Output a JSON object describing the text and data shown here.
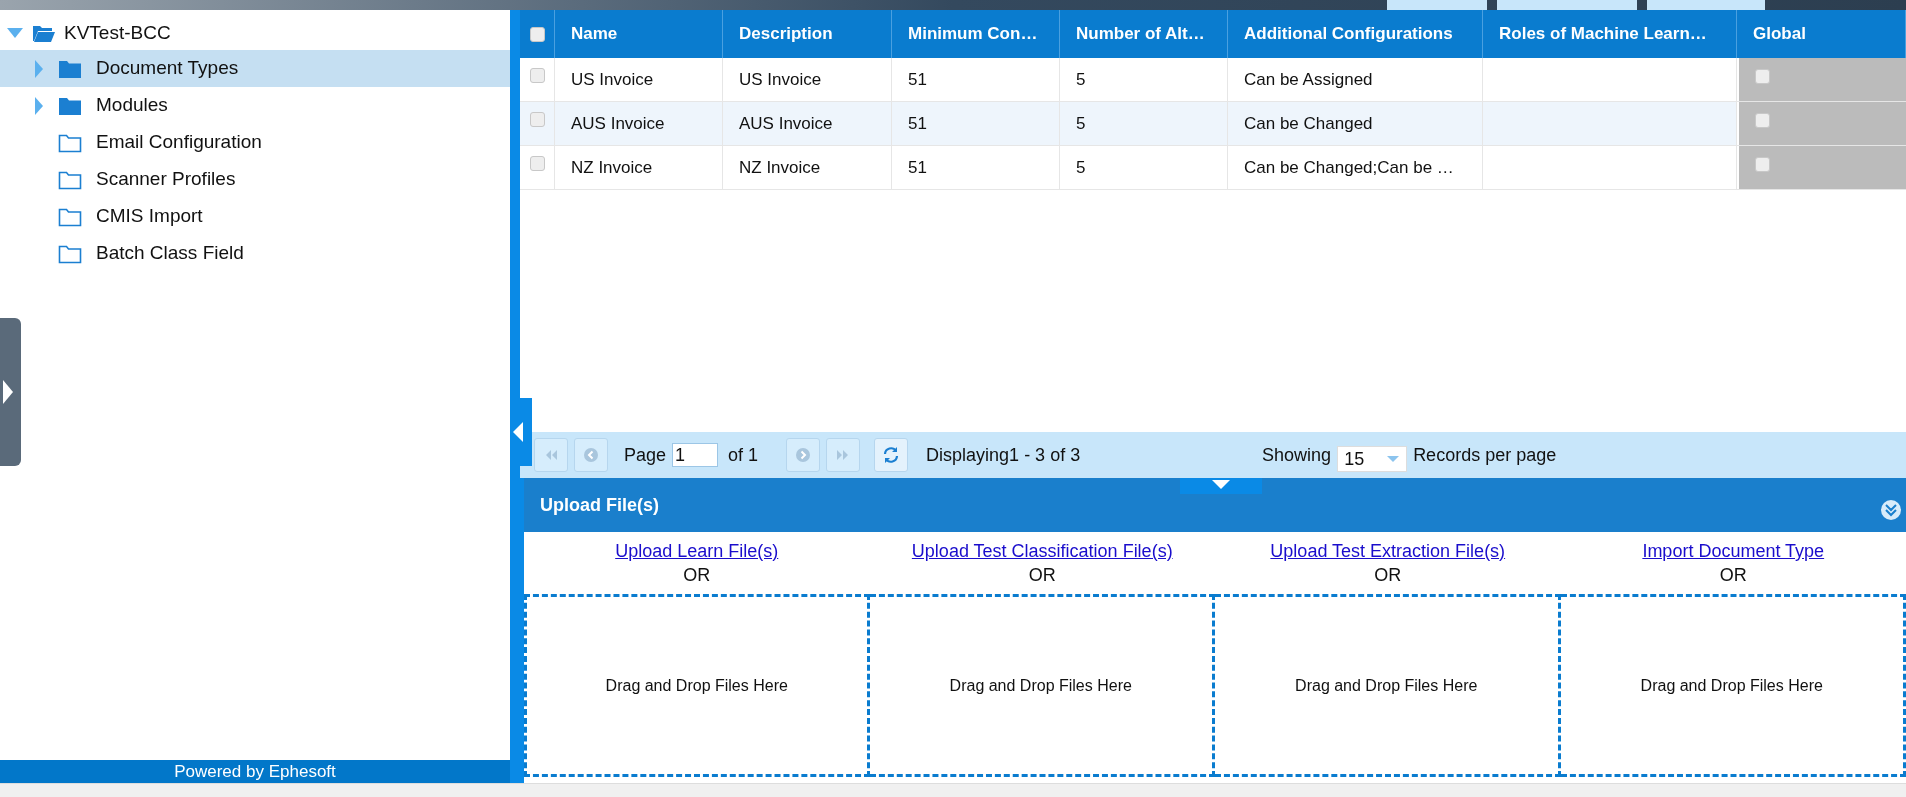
{
  "header": {
    "tabs": [
      {
        "selected": false
      },
      {
        "selected": false
      },
      {
        "selected": false
      }
    ]
  },
  "tree": {
    "label": "KVTest-BCC",
    "expanded": true,
    "children": [
      {
        "label": "Document Types",
        "kind": "branch",
        "expanded": false,
        "selected": true
      },
      {
        "label": "Modules",
        "kind": "branch",
        "expanded": false,
        "selected": false
      },
      {
        "label": "Email Configuration",
        "kind": "leaf",
        "selected": false
      },
      {
        "label": "Scanner Profiles",
        "kind": "leaf",
        "selected": false
      },
      {
        "label": "CMIS Import",
        "kind": "leaf",
        "selected": false
      },
      {
        "label": "Batch Class Field",
        "kind": "leaf",
        "selected": false
      }
    ]
  },
  "footer": "Powered by Ephesoft",
  "table": {
    "select_all": false,
    "columns": [
      "Name",
      "Description",
      "Minimum Con…",
      "Number of Alt…",
      "Additional Configurations",
      "Roles of Machine Learn…",
      "Global"
    ],
    "rows": [
      {
        "checked": false,
        "cells": [
          "US Invoice",
          "US Invoice",
          "51",
          "5",
          "Can be Assigned",
          ""
        ],
        "global": false
      },
      {
        "checked": false,
        "cells": [
          "AUS Invoice",
          "AUS Invoice",
          "51",
          "5",
          "Can be Changed",
          ""
        ],
        "global": false
      },
      {
        "checked": false,
        "cells": [
          "NZ Invoice",
          "NZ Invoice",
          "51",
          "5",
          "Can be Changed;Can be …",
          ""
        ],
        "global": false
      }
    ]
  },
  "pager": {
    "page_label": "Page",
    "page": "1",
    "of": "of 1",
    "displaying": "Displaying1 - 3 of 3",
    "showing": "Showing",
    "per_page": "15",
    "records_label": "Records per page"
  },
  "upload": {
    "title": "Upload File(s)",
    "columns": [
      {
        "link": "Upload Learn File(s)",
        "or": "OR",
        "drop": "Drag and Drop Files Here"
      },
      {
        "link": "Upload Test Classification File(s)",
        "or": "OR",
        "drop": "Drag and Drop Files Here"
      },
      {
        "link": "Upload Test Extraction File(s)",
        "or": "OR",
        "drop": "Drag and Drop Files Here"
      },
      {
        "link": "Import Document Type",
        "or": "OR",
        "drop": "Drag and Drop Files Here"
      }
    ]
  }
}
